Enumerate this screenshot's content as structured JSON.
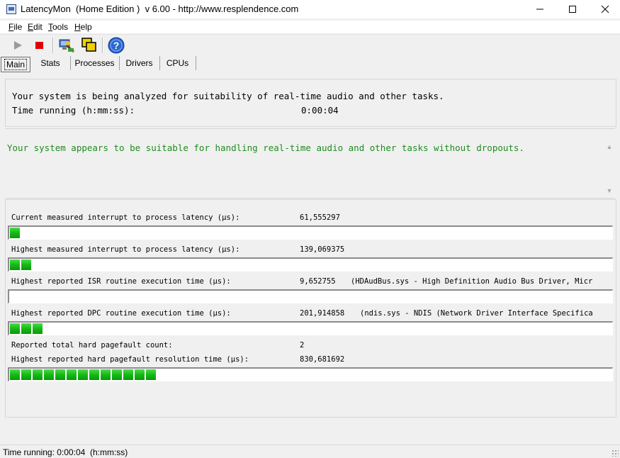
{
  "window": {
    "title": "LatencyMon  (Home Edition )  v 6.00 - http://www.resplendence.com",
    "minimize": "—",
    "maximize": "☐",
    "close": "✕"
  },
  "menu": [
    {
      "label": "File",
      "hotkey": "F",
      "rest": "ile"
    },
    {
      "label": "Edit",
      "hotkey": "E",
      "rest": "dit"
    },
    {
      "label": "Tools",
      "hotkey": "T",
      "rest": "ools"
    },
    {
      "label": "Help",
      "hotkey": "H",
      "rest": "elp"
    }
  ],
  "toolbar": {
    "icons": [
      "play-icon",
      "stop-icon",
      "computer-scan-icon",
      "windows-icon",
      "help-icon"
    ]
  },
  "tabs": [
    {
      "label": "Main",
      "active": true
    },
    {
      "label": "Stats",
      "active": false
    },
    {
      "label": "Processes",
      "active": false
    },
    {
      "label": "Drivers",
      "active": false
    },
    {
      "label": "CPUs",
      "active": false
    }
  ],
  "analysis": {
    "line1": "Your system is being analyzed for suitability of real-time audio and other tasks.",
    "time_label": "Time running (h:mm:ss):",
    "time_value": "0:00:04"
  },
  "verdict": {
    "text": "Your system appears to be suitable for handling real-time audio and other tasks without dropouts.",
    "color": "#1e8c1e"
  },
  "metrics": {
    "current_latency": {
      "label": "Current measured interrupt to process latency (µs):",
      "value": "61,555297",
      "bar_segments": 1
    },
    "highest_latency": {
      "label": "Highest measured interrupt to process latency (µs):",
      "value": "139,069375",
      "bar_segments": 2
    },
    "isr": {
      "label": "Highest reported ISR routine execution time (µs):",
      "value": "9,652755",
      "extra": "(HDAudBus.sys - High Definition Audio Bus Driver, Micr",
      "bar_segments": 0
    },
    "dpc": {
      "label": "Highest reported DPC routine execution time (µs):",
      "value": "201,914858",
      "extra": "(ndis.sys - NDIS (Network Driver Interface Specifica",
      "bar_segments": 3
    },
    "pagefault_count": {
      "label": "Reported total hard pagefault count:",
      "value": "2"
    },
    "pagefault_resolution": {
      "label": "Highest reported hard pagefault resolution time (µs):",
      "value": "830,681692",
      "bar_segments": 13
    }
  },
  "statusbar": {
    "text": "Time running: 0:00:04  (h:mm:ss)"
  }
}
